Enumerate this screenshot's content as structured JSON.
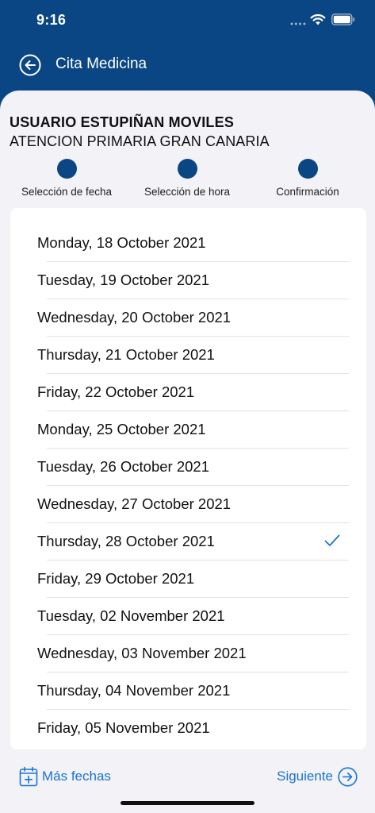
{
  "status_bar": {
    "time": "9:16"
  },
  "nav": {
    "title": "Cita Medicina",
    "back_icon": "arrow-left-circle-icon"
  },
  "header": {
    "user_name": "USUARIO ESTUPIÑAN MOVILES",
    "center_name": "ATENCION PRIMARIA GRAN CANARIA"
  },
  "steps": [
    {
      "label": "Selección de fecha"
    },
    {
      "label": "Selección de hora"
    },
    {
      "label": "Confirmación"
    }
  ],
  "dates": [
    {
      "label": "Monday, 18 October 2021",
      "selected": false
    },
    {
      "label": "Tuesday, 19 October 2021",
      "selected": false
    },
    {
      "label": "Wednesday, 20 October 2021",
      "selected": false
    },
    {
      "label": "Thursday, 21 October 2021",
      "selected": false
    },
    {
      "label": "Friday, 22 October 2021",
      "selected": false
    },
    {
      "label": "Monday, 25 October 2021",
      "selected": false
    },
    {
      "label": "Tuesday, 26 October 2021",
      "selected": false
    },
    {
      "label": "Wednesday, 27 October 2021",
      "selected": false
    },
    {
      "label": "Thursday, 28 October 2021",
      "selected": true
    },
    {
      "label": "Friday, 29 October 2021",
      "selected": false
    },
    {
      "label": "Tuesday, 02 November 2021",
      "selected": false
    },
    {
      "label": "Wednesday, 03 November 2021",
      "selected": false
    },
    {
      "label": "Thursday, 04 November 2021",
      "selected": false
    },
    {
      "label": "Friday, 05 November 2021",
      "selected": false
    }
  ],
  "footer": {
    "more_dates_label": "Más fechas",
    "next_label": "Siguiente"
  },
  "colors": {
    "brand": "#0a4683",
    "accent": "#1a74d2",
    "background": "#f2f2f7"
  }
}
